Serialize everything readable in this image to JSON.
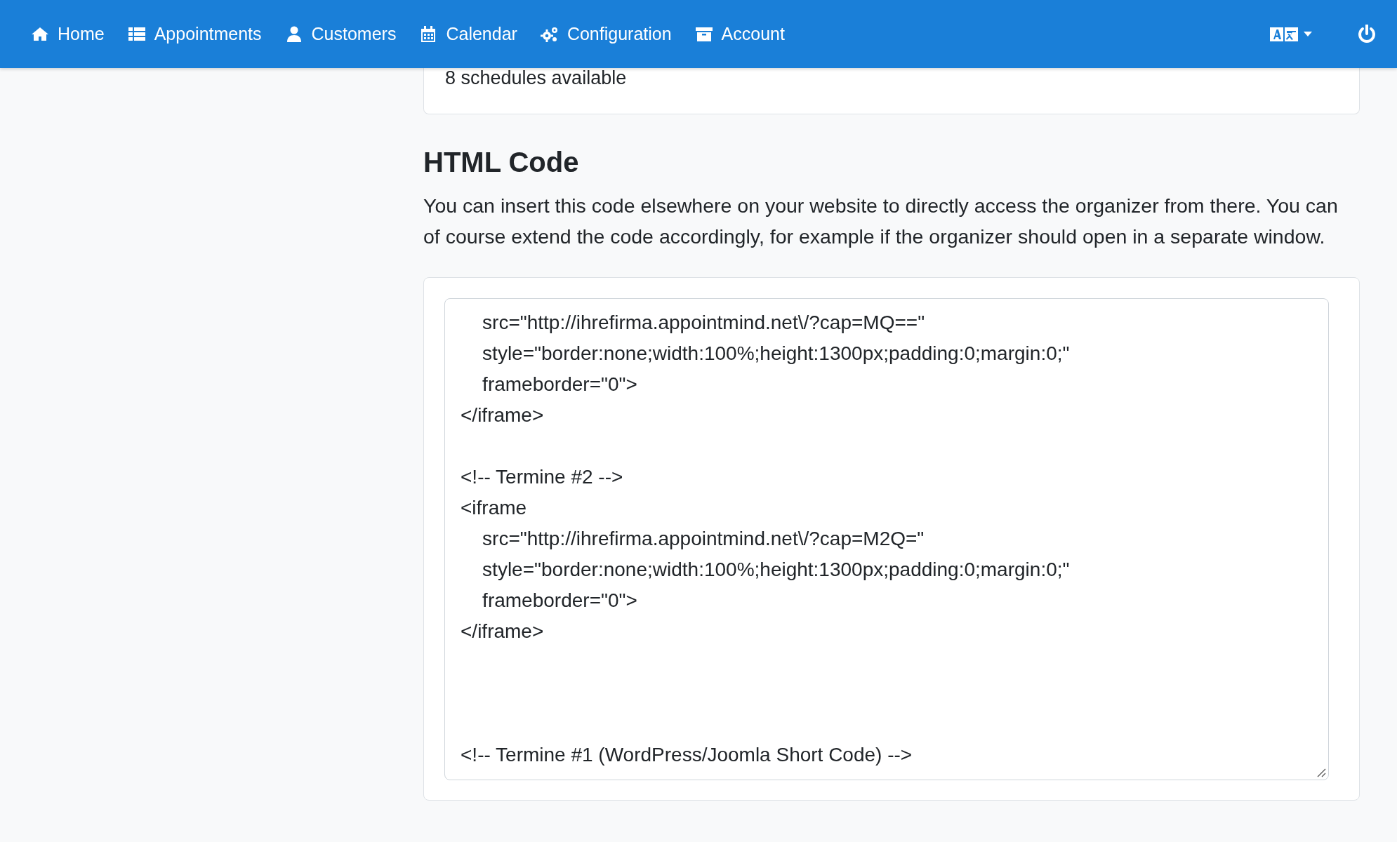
{
  "navbar": {
    "items": [
      {
        "label": "Home"
      },
      {
        "label": "Appointments"
      },
      {
        "label": "Customers"
      },
      {
        "label": "Calendar"
      },
      {
        "label": "Configuration"
      },
      {
        "label": "Account"
      }
    ]
  },
  "schedules_card": {
    "text": "8 schedules available"
  },
  "section": {
    "heading": "HTML Code",
    "description": "You can insert this code elsewhere on your website to directly access the organizer from there. You can of course extend the code accordingly, for example if the organizer should open in a separate window."
  },
  "code_field": {
    "value": "    src=\"http://ihrefirma.appointmind.net\\/?cap=MQ==\"\n    style=\"border:none;width:100%;height:1300px;padding:0;margin:0;\"\n    frameborder=\"0\">\n</iframe>\n\n<!-- Termine #2 -->\n<iframe\n    src=\"http://ihrefirma.appointmind.net\\/?cap=M2Q=\"\n    style=\"border:none;width:100%;height:1300px;padding:0;margin:0;\"\n    frameborder=\"0\">\n</iframe>\n\n\n\n<!-- Termine #1 (WordPress/Joomla Short Code) -->"
  }
}
